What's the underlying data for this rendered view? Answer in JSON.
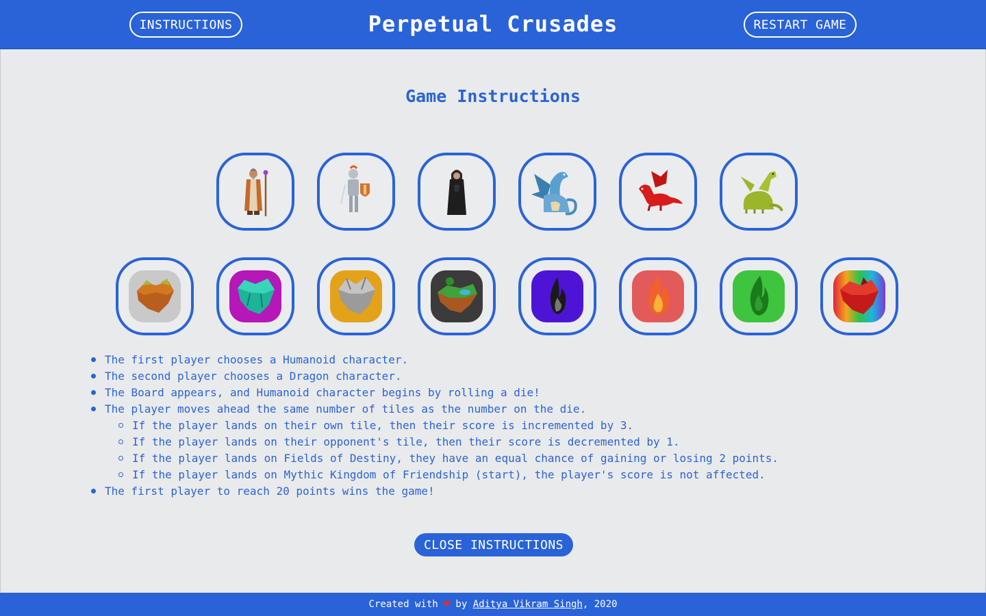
{
  "header": {
    "title": "Perpetual Crusades",
    "instructions_label": "INSTRUCTIONS",
    "restart_label": "RESTART GAME"
  },
  "instructions": {
    "title": "Game Instructions",
    "characters": [
      {
        "icon": "wizard-icon"
      },
      {
        "icon": "knight-icon"
      },
      {
        "icon": "monk-icon"
      },
      {
        "icon": "blue-dragon-icon"
      },
      {
        "icon": "red-dragon-icon"
      },
      {
        "icon": "green-dragon-icon"
      }
    ],
    "tiles": [
      {
        "icon": "earth-island-tile-icon",
        "color": "#c9c9c9"
      },
      {
        "icon": "crystal-island-tile-icon",
        "color": "#b517b8"
      },
      {
        "icon": "stone-island-tile-icon",
        "color": "#e3a21a"
      },
      {
        "icon": "forest-island-tile-icon",
        "color": "#3b3b3b"
      },
      {
        "icon": "dark-flame-tile-icon",
        "color": "#4e14d6"
      },
      {
        "icon": "fire-flame-tile-icon",
        "color": "#e25a5a"
      },
      {
        "icon": "green-flame-tile-icon",
        "color": "#3ec43e"
      },
      {
        "icon": "rainbow-island-tile-icon",
        "color": "#e0233a"
      }
    ],
    "rules": [
      "The first player chooses a Humanoid character.",
      "The second player chooses a Dragon character.",
      "The Board appears, and Humanoid character begins by rolling a die!",
      "The player moves ahead the same number of tiles as the number on the die."
    ],
    "sub_rules": [
      "If the player lands on their own tile, then their score is incremented by 3.",
      "If the player lands on their opponent's tile, then their score is decremented by 1.",
      "If the player lands on Fields of Destiny, they have an equal chance of gaining or losing 2 points.",
      "If the player lands on Mythic Kingdom of Friendship (start), the player's score is not affected."
    ],
    "final_rule": "The first player to reach 20 points wins the game!",
    "close_label": "CLOSE INSTRUCTIONS"
  },
  "footer": {
    "prefix": "Created with",
    "heart": "❤",
    "by": "by",
    "author": "Aditya Vikram Singh",
    "year_suffix": ", 2020"
  },
  "colors": {
    "accent": "#2a63d8",
    "background": "#e9eaeb",
    "heart": "#e32b2b"
  }
}
